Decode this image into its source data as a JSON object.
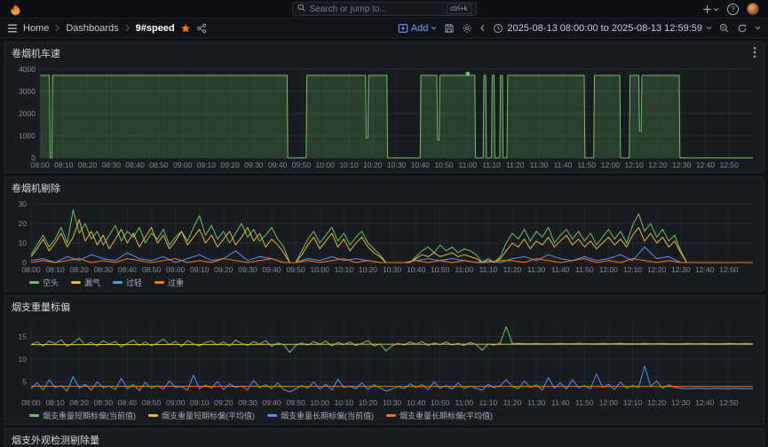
{
  "header": {
    "search_placeholder": "Search or jump to...",
    "search_shortcut": "ctrl+k"
  },
  "nav": {
    "breadcrumb": [
      "Home",
      "Dashboards",
      "9#speed"
    ],
    "add_label": "Add",
    "time_range": "2025-08-13 08:00:00 to 2025-08-13 12:59:59"
  },
  "panels": [
    {
      "title": "卷烟机车速"
    },
    {
      "title": "卷烟机剔除"
    },
    {
      "title": "烟支重量标偏"
    },
    {
      "title": "烟支外观检测剔除量"
    }
  ],
  "colors": {
    "green": "#73bf69",
    "yellow": "#eab839",
    "blue": "#5794f2",
    "orange": "#ff780a",
    "accent_blue": "#6e9fff",
    "star_orange": "#eb7b18",
    "panel_bg": "#181b1f"
  },
  "chart_data": [
    {
      "type": "area",
      "title": "卷烟机车速",
      "xlim": [
        0,
        300
      ],
      "ylim": [
        0,
        4000
      ],
      "y_ticks": [
        0,
        1000,
        2000,
        3000,
        4000
      ],
      "x_unit": "minutes after 08:00",
      "x_ticks": [
        "08:00",
        "08:10",
        "08:20",
        "08:30",
        "08:40",
        "08:50",
        "09:00",
        "09:10",
        "09:20",
        "09:30",
        "09:40",
        "09:50",
        "10:00",
        "10:10",
        "10:20",
        "10:30",
        "10:40",
        "10:50",
        "11:00",
        "11:10",
        "11:20",
        "11:30",
        "11:40",
        "11:50",
        "12:00",
        "12:10",
        "12:20",
        "12:30",
        "12:40",
        "12:50"
      ],
      "legend": false,
      "marker": {
        "x": 180,
        "y": 3790
      },
      "series": [
        {
          "name": "车速",
          "color": "#73bf69",
          "fill": true,
          "points": [
            [
              0,
              3720
            ],
            [
              4,
              3720
            ],
            [
              4.3,
              0
            ],
            [
              5,
              0
            ],
            [
              5.3,
              3720
            ],
            [
              104,
              3720
            ],
            [
              104.3,
              0
            ],
            [
              112,
              0
            ],
            [
              112.3,
              3720
            ],
            [
              137,
              3720
            ],
            [
              137.3,
              900
            ],
            [
              138,
              900
            ],
            [
              138.3,
              3720
            ],
            [
              146,
              3720
            ],
            [
              146.3,
              0
            ],
            [
              160,
              0
            ],
            [
              160.3,
              3720
            ],
            [
              167,
              3720
            ],
            [
              167.3,
              800
            ],
            [
              168,
              800
            ],
            [
              168.3,
              3720
            ],
            [
              183,
              3720
            ],
            [
              183.3,
              0
            ],
            [
              186.5,
              0
            ],
            [
              186.8,
              3720
            ],
            [
              187.6,
              3720
            ],
            [
              187.9,
              0
            ],
            [
              190,
              0
            ],
            [
              190.3,
              3720
            ],
            [
              191.1,
              3720
            ],
            [
              191.4,
              0
            ],
            [
              193.5,
              0
            ],
            [
              193.8,
              3720
            ],
            [
              194.6,
              3720
            ],
            [
              194.9,
              0
            ],
            [
              196.5,
              0
            ],
            [
              196.8,
              3720
            ],
            [
              229,
              3720
            ],
            [
              229.3,
              0
            ],
            [
              233,
              0
            ],
            [
              233.3,
              3720
            ],
            [
              244,
              3720
            ],
            [
              244.3,
              0
            ],
            [
              248,
              0
            ],
            [
              248.3,
              3720
            ],
            [
              252,
              3720
            ],
            [
              252.3,
              1200
            ],
            [
              253,
              1200
            ],
            [
              253.3,
              3720
            ],
            [
              269,
              3720
            ],
            [
              269.3,
              0
            ],
            [
              300,
              0
            ]
          ]
        }
      ]
    },
    {
      "type": "line",
      "title": "卷烟机剔除",
      "xlim": [
        0,
        300
      ],
      "ylim": [
        0,
        30
      ],
      "y_ticks": [
        0,
        10,
        20,
        30
      ],
      "x_unit": "minutes after 08:00",
      "x_ticks": [
        "08:00",
        "08:10",
        "08:20",
        "08:30",
        "08:40",
        "08:50",
        "09:00",
        "09:10",
        "09:20",
        "09:30",
        "09:40",
        "09:50",
        "10:00",
        "10:10",
        "10:20",
        "10:30",
        "10:40",
        "10:50",
        "11:00",
        "11:10",
        "11:20",
        "11:30",
        "11:40",
        "11:50",
        "12:00",
        "12:10",
        "12:20",
        "12:30",
        "12:40",
        "12:50"
      ],
      "legend": true,
      "series": [
        {
          "name": "空头",
          "color": "#73bf69",
          "x_step": 2.5,
          "values": [
            4,
            9,
            14,
            8,
            12,
            18,
            10,
            27,
            15,
            20,
            12,
            16,
            9,
            14,
            19,
            11,
            16,
            13,
            18,
            10,
            15,
            12,
            17,
            9,
            13,
            16,
            11,
            18,
            24,
            14,
            19,
            12,
            16,
            10,
            15,
            20,
            13,
            17,
            11,
            14,
            18,
            12,
            8,
            0,
            0,
            6,
            12,
            16,
            10,
            14,
            18,
            11,
            15,
            9,
            13,
            16,
            10,
            7,
            4,
            0,
            0,
            0,
            0,
            0,
            3,
            6,
            8,
            5,
            9,
            6,
            8,
            5,
            7,
            6,
            4,
            0,
            2,
            0,
            3,
            10,
            15,
            12,
            17,
            11,
            16,
            13,
            18,
            10,
            14,
            17,
            12,
            16,
            11,
            15,
            9,
            13,
            17,
            12,
            16,
            10,
            19,
            25,
            16,
            20,
            13,
            17,
            11,
            14,
            6,
            0,
            0,
            0,
            0,
            0,
            0,
            0,
            0,
            0,
            0,
            0,
            0
          ]
        },
        {
          "name": "漏气",
          "color": "#eab839",
          "x_step": 2.5,
          "values": [
            3,
            7,
            12,
            6,
            10,
            15,
            8,
            13,
            22,
            11,
            16,
            9,
            14,
            7,
            12,
            17,
            10,
            15,
            8,
            13,
            18,
            10,
            14,
            7,
            11,
            16,
            9,
            13,
            17,
            10,
            14,
            8,
            12,
            16,
            9,
            13,
            18,
            11,
            15,
            8,
            12,
            9,
            5,
            0,
            0,
            4,
            9,
            13,
            7,
            11,
            15,
            8,
            12,
            6,
            10,
            13,
            8,
            5,
            3,
            0,
            0,
            0,
            0,
            0,
            2,
            4,
            3,
            5,
            3,
            4,
            5,
            3,
            4,
            3,
            2,
            0,
            1,
            0,
            2,
            6,
            10,
            8,
            12,
            7,
            11,
            9,
            13,
            8,
            11,
            14,
            9,
            12,
            8,
            11,
            7,
            10,
            13,
            9,
            12,
            8,
            14,
            18,
            11,
            15,
            10,
            13,
            8,
            11,
            5,
            0,
            0,
            0,
            0,
            0,
            0,
            0,
            0,
            0,
            0,
            0,
            0
          ]
        },
        {
          "name": "过轻",
          "color": "#5794f2",
          "x_step": 5,
          "values": [
            1,
            2,
            0,
            3,
            1,
            4,
            2,
            1,
            5,
            2,
            1,
            3,
            0,
            2,
            4,
            1,
            2,
            6,
            1,
            3,
            2,
            0,
            0,
            2,
            1,
            3,
            1,
            2,
            1,
            0,
            0,
            0,
            1,
            2,
            1,
            2,
            1,
            0,
            1,
            0,
            2,
            3,
            1,
            4,
            2,
            1,
            3,
            1,
            2,
            4,
            1,
            8,
            2,
            3,
            0,
            0,
            0,
            0,
            0,
            0,
            0
          ]
        },
        {
          "name": "过重",
          "color": "#ff780a",
          "x_step": 5,
          "values": [
            0,
            1,
            0,
            1,
            2,
            0,
            1,
            0,
            2,
            1,
            0,
            1,
            2,
            0,
            1,
            0,
            2,
            1,
            0,
            1,
            2,
            0,
            0,
            1,
            0,
            1,
            2,
            0,
            1,
            0,
            0,
            0,
            1,
            0,
            1,
            0,
            1,
            0,
            0,
            1,
            1,
            0,
            2,
            1,
            0,
            1,
            2,
            0,
            1,
            0,
            2,
            1,
            0,
            1,
            0,
            0,
            0,
            0,
            0,
            0,
            0
          ]
        }
      ]
    },
    {
      "type": "line",
      "title": "烟支重量标偏",
      "xlim": [
        0,
        300
      ],
      "ylim": [
        2,
        18
      ],
      "y_ticks": [
        5,
        10,
        15
      ],
      "x_unit": "minutes after 08:00",
      "x_ticks": [
        "08:00",
        "08:10",
        "08:20",
        "08:30",
        "08:40",
        "08:50",
        "09:00",
        "09:10",
        "09:20",
        "09:30",
        "09:40",
        "09:50",
        "10:00",
        "10:10",
        "10:20",
        "10:30",
        "10:40",
        "10:50",
        "11:00",
        "11:10",
        "11:20",
        "11:30",
        "11:40",
        "11:50",
        "12:00",
        "12:10",
        "12:20",
        "12:30",
        "12:40",
        "12:50"
      ],
      "legend": true,
      "series": [
        {
          "name": "烟支重量短期标偏(当前值)",
          "color": "#73bf69",
          "x_step": 2.5,
          "values": [
            13.2,
            13.8,
            12.9,
            14.0,
            13.4,
            14.3,
            12.8,
            13.6,
            14.6,
            13.1,
            13.7,
            12.9,
            14.1,
            13.3,
            13.9,
            12.7,
            13.5,
            14.2,
            13.0,
            13.8,
            12.9,
            13.6,
            14.4,
            13.2,
            13.9,
            12.8,
            14.1,
            13.4,
            12.9,
            13.7,
            14.0,
            13.1,
            13.8,
            12.9,
            14.2,
            13.5,
            13.0,
            13.9,
            13.3,
            14.1,
            12.8,
            13.6,
            13.2,
            11.5,
            13.0,
            13.6,
            13.1,
            13.9,
            13.3,
            14.0,
            12.9,
            13.7,
            13.2,
            13.8,
            13.0,
            13.5,
            14.1,
            12.9,
            13.4,
            11.8,
            12.9,
            13.5,
            13.1,
            13.8,
            13.3,
            13.9,
            13.0,
            13.6,
            13.2,
            13.8,
            13.1,
            13.5,
            13.0,
            13.7,
            13.2,
            12.0,
            13.4,
            13.1,
            13.6,
            17.2,
            13.4,
            13.5,
            13.4,
            13.4,
            13.5,
            13.4,
            13.4,
            13.4,
            13.5,
            13.4,
            13.4,
            13.5,
            13.4,
            13.4,
            13.4,
            13.5,
            13.4,
            13.4,
            13.5,
            13.4,
            13.4,
            13.4,
            13.5,
            13.4,
            13.4,
            13.5,
            13.4,
            13.4,
            13.4,
            13.5,
            13.4,
            13.4,
            13.5,
            13.4,
            13.4,
            13.4,
            13.5,
            13.4,
            13.4,
            13.5,
            13.4
          ]
        },
        {
          "name": "烟支重量短期标偏(平均值)",
          "color": "#eab839",
          "points": [
            [
              0,
              13.2
            ],
            [
              150,
              13.3
            ],
            [
              300,
              13.3
            ]
          ]
        },
        {
          "name": "烟支重量长期标偏(当前值)",
          "color": "#5794f2",
          "x_step": 2.5,
          "values": [
            3.5,
            4.8,
            3.2,
            5.5,
            3.8,
            4.2,
            3.0,
            6.2,
            3.6,
            4.5,
            3.2,
            5.0,
            3.7,
            4.1,
            3.3,
            5.8,
            3.5,
            4.4,
            3.1,
            4.9,
            3.6,
            4.2,
            3.4,
            5.2,
            3.8,
            4.0,
            3.2,
            6.5,
            3.5,
            4.3,
            3.6,
            5.1,
            3.3,
            4.6,
            3.8,
            4.1,
            3.2,
            5.4,
            3.7,
            4.4,
            3.5,
            4.8,
            3.3,
            2.8,
            3.5,
            4.2,
            3.6,
            5.0,
            3.4,
            4.5,
            3.2,
            5.6,
            3.8,
            4.1,
            3.5,
            4.8,
            3.3,
            4.4,
            3.7,
            3.0,
            3.4,
            4.0,
            3.5,
            4.6,
            3.8,
            4.4,
            3.3,
            5.0,
            3.6,
            4.2,
            3.4,
            4.8,
            3.5,
            4.1,
            3.6,
            3.2,
            4.5,
            3.7,
            4.2,
            5.5,
            4.0,
            3.5,
            5.2,
            3.8,
            4.4,
            3.2,
            6.0,
            3.6,
            4.8,
            3.4,
            5.5,
            3.7,
            4.2,
            3.5,
            6.8,
            3.8,
            4.5,
            3.3,
            5.0,
            3.6,
            4.2,
            3.8,
            8.5,
            4.0,
            5.2,
            3.6,
            4.4,
            3.8,
            3.6,
            3.5,
            3.5,
            3.6,
            3.5,
            3.5,
            3.6,
            3.5,
            3.5,
            3.6,
            3.5,
            3.5,
            3.5
          ]
        },
        {
          "name": "烟支重量长期标偏(平均值)",
          "color": "#ff780a",
          "points": [
            [
              0,
              4.05
            ],
            [
              150,
              4.0
            ],
            [
              300,
              4.0
            ]
          ]
        }
      ]
    }
  ]
}
